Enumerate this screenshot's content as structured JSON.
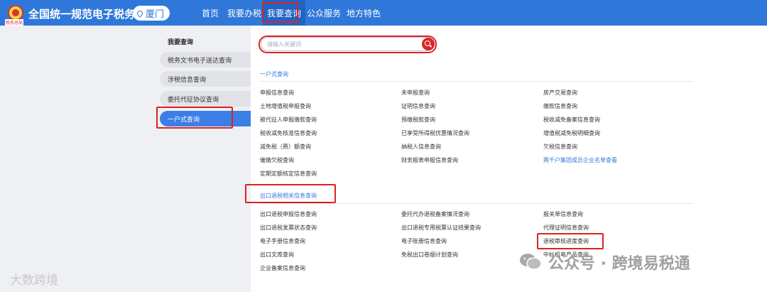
{
  "header": {
    "logo_caption": "税务总局",
    "title": "全国统一规范电子税务局",
    "city": "厦门",
    "nav": [
      "首页",
      "我要办税",
      "我要查询",
      "公众服务",
      "地方特色"
    ]
  },
  "sidebar": {
    "title": "我要查询",
    "items": [
      "税务文书电子送达查询",
      "涉税信息查询",
      "委托代征协议查询",
      "一户式查询"
    ]
  },
  "search": {
    "placeholder": "请输入关键词"
  },
  "sections": [
    {
      "title": "一户式查询",
      "rows": [
        [
          "申报信息查询",
          "未申报查询",
          "房产交易查询"
        ],
        [
          "土地增值税申报查询",
          "证明信息查询",
          "缴款信息查询"
        ],
        [
          "被代征人申报缴款查询",
          "预缴税款查询",
          "税收减免备案信息查询"
        ],
        [
          "税收减免核准信息查询",
          "已享受所得税优惠情况查询",
          "增值税减免税明细查询"
        ],
        [
          "减免税（费）额查询",
          "纳税人信息查询",
          "欠税信息查询"
        ],
        [
          "催缴欠税查询",
          "财务报表申报信息查询",
          "两千户集团成员企业名单查看"
        ],
        [
          "定期定额核定信息查询",
          "",
          ""
        ]
      ]
    },
    {
      "title": "出口退税相关信息查询",
      "rows": [
        [
          "出口退税申报信息查询",
          "委托代办退税备案情况查询",
          "报关单信息查询"
        ],
        [
          "出口退税发票状态查询",
          "出口退税专用税票认证结果查询",
          "代理证明信息查询"
        ],
        [
          "电子手册信息查询",
          "电子账册信息查询",
          "退税审核进度查询"
        ],
        [
          "出口文库查询",
          "免税出口卷烟计划查询",
          "中标机电产品查询"
        ],
        [
          "企业备案信息查询",
          "",
          ""
        ]
      ]
    }
  ],
  "watermarks": {
    "left": "大数跨境",
    "right": "公众号 · 跨境易税通"
  },
  "colors": {
    "brand": "#2f78d9",
    "highlight": "#e02020",
    "sidebar_active": "#3b7ee6"
  }
}
